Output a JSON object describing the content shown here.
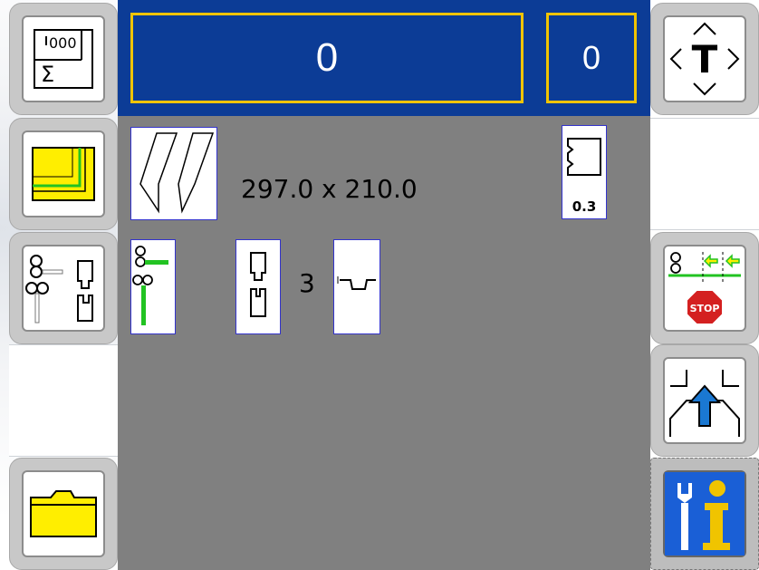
{
  "header": {
    "counter_main": "0",
    "counter_secondary": "0"
  },
  "job": {
    "sheet_dimensions": "297.0 x 210.0",
    "thickness": "0.3",
    "tool_count": "3"
  },
  "left_buttons": [
    {
      "icon": "sigma-counter-icon"
    },
    {
      "icon": "layers-icon"
    },
    {
      "icon": "tooling-icon"
    },
    {
      "icon": "empty"
    },
    {
      "icon": "folder-icon"
    }
  ],
  "right_buttons": [
    {
      "icon": "move-t-icon"
    },
    {
      "icon": "empty"
    },
    {
      "icon": "backgauge-stop-icon"
    },
    {
      "icon": "open-press-icon"
    },
    {
      "icon": "service-info-icon"
    }
  ],
  "colors": {
    "header_blue": "#0c3c96",
    "frame_yellow": "#f0c400",
    "panel_gray": "#808080",
    "accent_green": "#22c322",
    "folder_yellow": "#ffee00",
    "arrow_blue": "#1a78d2",
    "stop_red": "#d42020"
  }
}
